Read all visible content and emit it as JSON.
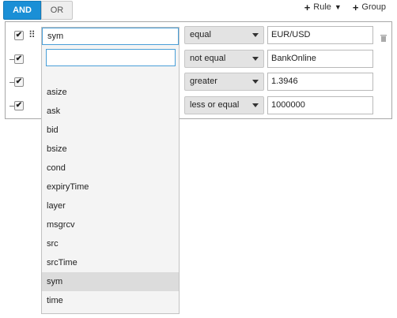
{
  "logic": {
    "and_label": "AND",
    "or_label": "OR"
  },
  "actions": {
    "rule_label": "Rule",
    "group_label": "Group"
  },
  "rules": [
    {
      "field": "sym",
      "operator": "equal",
      "value": "EUR/USD"
    },
    {
      "field": "",
      "operator": "not equal",
      "value": "BankOnline"
    },
    {
      "field": "",
      "operator": "greater",
      "value": "1.3946"
    },
    {
      "field": "",
      "operator": "less or equal",
      "value": "1000000"
    }
  ],
  "dropdown": {
    "selected": "sym",
    "search_value": "",
    "options": [
      "asize",
      "ask",
      "bid",
      "bsize",
      "cond",
      "expiryTime",
      "layer",
      "msgrcv",
      "src",
      "srcTime",
      "sym",
      "time"
    ]
  },
  "colors": {
    "accent": "#1a8fd6",
    "selected_bg": "#dcdcdc"
  }
}
